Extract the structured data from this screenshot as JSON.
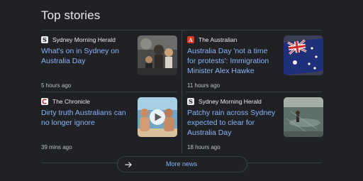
{
  "section": {
    "title": "Top stories"
  },
  "stories": [
    {
      "source": "Sydney Morning Herald",
      "headline": "What's on in Sydney on Australia Day",
      "time": "5 hours ago",
      "source_icon": "smh-logo-icon",
      "thumbnail": "crowd-performance-image"
    },
    {
      "source": "The Australian",
      "headline": "Australia Day 'not a time for protests': Immigration Minister Alex Hawke",
      "time": "11 hours ago",
      "source_icon": "the-australian-logo-icon",
      "thumbnail": "australian-flag-image"
    },
    {
      "source": "The Chronicle",
      "headline": "Dirty truth Australians can no longer ignore",
      "time": "39 mins ago",
      "source_icon": "chronicle-logo-icon",
      "thumbnail": "beach-people-video-image"
    },
    {
      "source": "Sydney Morning Herald",
      "headline": "Patchy rain across Sydney expected to clear for Australia Day",
      "time": "18 hours ago",
      "source_icon": "smh-logo-icon",
      "thumbnail": "rain-water-image"
    }
  ],
  "more": {
    "label": "More news",
    "icon": "arrow-right-icon"
  },
  "colors": {
    "background": "#202124",
    "link": "#8ab4f8",
    "text": "#e8eaed",
    "muted": "#bdc1c6",
    "divider": "#3c4043"
  }
}
